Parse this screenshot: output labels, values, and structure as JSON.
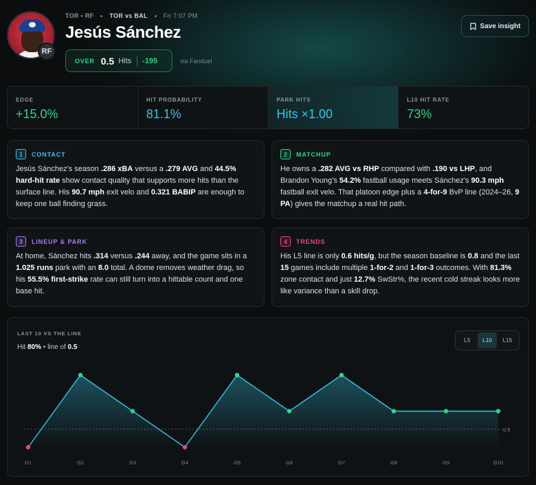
{
  "header": {
    "team": "TOR",
    "position": "RF",
    "matchup": "TOR vs BAL",
    "game_time": "Fri 7:07 PM",
    "player_name": "Jesús Sánchez",
    "position_badge": "RF",
    "prop": {
      "direction": "OVER",
      "line": "0.5",
      "stat": "Hits",
      "odds": "-195"
    },
    "sportsbook": "via Fanduel",
    "save_label": "Save insight"
  },
  "metrics": [
    {
      "label": "EDGE",
      "value": "+15.0%",
      "color": "#2fd68d"
    },
    {
      "label": "HIT PROBABILITY",
      "value": "81.1%",
      "color": "#35c6e8"
    },
    {
      "label": "PARK HITS",
      "value": "Hits ×1.00",
      "color": "#35c6e8"
    },
    {
      "label": "L10 HIT RATE",
      "value": "73%",
      "color": "#2fd68d"
    }
  ],
  "cards": [
    {
      "num": "1",
      "title": "CONTACT",
      "color": "#35c6e8",
      "text": [
        "Jesús Sánchez's season ",
        "**.286 xBA",
        " versus a ",
        "**.279 AVG",
        " and ",
        "**44.5% hard-hit rate",
        " show contact quality that supports more hits than the surface line. His ",
        "**90.7 mph",
        " exit velo and ",
        "**0.321 BABIP",
        " are enough to keep one ball finding grass."
      ]
    },
    {
      "num": "2",
      "title": "MATCHUP",
      "color": "#2fd68d",
      "text": [
        "He owns a ",
        "**.282 AVG vs RHP",
        " compared with ",
        "**.190 vs LHP",
        ", and Brandon Young's ",
        "**54.2%",
        " fastball usage meets Sánchez's ",
        "**90.3 mph",
        " fastball exit velo. That platoon edge plus a ",
        "**4-for-9",
        " BvP line (2024–26, ",
        "**9 PA",
        ") gives the matchup a real hit path."
      ]
    },
    {
      "num": "3",
      "title": "LINEUP & PARK",
      "color": "#a77bf3",
      "text": [
        "At home, Sánchez hits ",
        "**.314",
        " versus ",
        "**.244",
        " away, and the game sits in a ",
        "**1.025 runs",
        " park with an ",
        "**8.0",
        " total. A dome removes weather drag, so his ",
        "**55.5% first-strike",
        " rate can still turn into a hittable count and one base hit."
      ]
    },
    {
      "num": "4",
      "title": "TRENDS",
      "color": "#e8458b",
      "text": [
        "His L5 line is only ",
        "**0.6 hits/g",
        ", but the season baseline is ",
        "**0.8",
        " and the last ",
        "**15",
        " games include multiple ",
        "**1-for-2",
        " and ",
        "**1-for-3",
        " outcomes. With ",
        "**81.3%",
        " zone contact and just ",
        "**12.7%",
        " SwStr%, the recent cold streak looks more like variance than a skill drop."
      ]
    }
  ],
  "chart": {
    "label": "LAST 10 VS THE LINE",
    "sub_prefix": "Hit ",
    "sub_rate": "80%",
    "sub_mid": " • line of ",
    "sub_line": "0.5",
    "tabs": [
      {
        "label": "L5",
        "active": false
      },
      {
        "label": "L10",
        "active": true
      },
      {
        "label": "L15",
        "active": false
      }
    ],
    "accent_color": "#35c6e8",
    "hit_color": "#2fd68d",
    "miss_color": "#e8458b"
  },
  "chart_data": {
    "type": "line",
    "x": [
      "G1",
      "G2",
      "G3",
      "G4",
      "G5",
      "G6",
      "G7",
      "G8",
      "G9",
      "G10"
    ],
    "series": [
      {
        "values": [
          0,
          2,
          1,
          0,
          2,
          1,
          2,
          1,
          1,
          1
        ]
      }
    ],
    "reference_line": {
      "value": 0.5,
      "label": "0.5"
    },
    "ylim": [
      0,
      2
    ]
  }
}
